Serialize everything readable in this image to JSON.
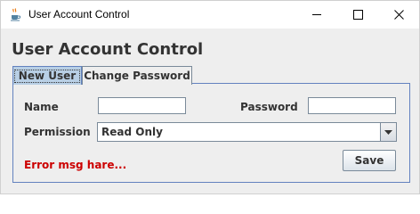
{
  "window": {
    "title": "User Account Control",
    "icon": "java-cup-icon"
  },
  "heading": "User Account Control",
  "tabs": [
    {
      "label": "New User",
      "active": true
    },
    {
      "label": "Change Password",
      "active": false
    }
  ],
  "form": {
    "name_label": "Name",
    "name_value": "",
    "password_label": "Password",
    "password_value": "",
    "permission_label": "Permission",
    "permission_selected": "Read Only"
  },
  "error_message": "Error msg hare...",
  "save_label": "Save",
  "colors": {
    "error": "#cc0000",
    "tab_active": "#b8cfe5",
    "border": "#6382bf"
  }
}
